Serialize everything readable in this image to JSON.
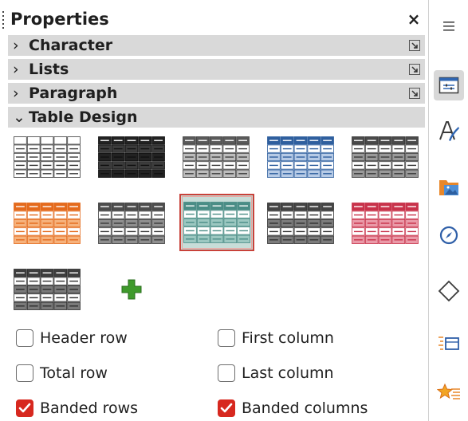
{
  "panel": {
    "title": "Properties",
    "close_glyph": "×",
    "sections": [
      {
        "label": "Character",
        "expanded": false
      },
      {
        "label": "Lists",
        "expanded": false
      },
      {
        "label": "Paragraph",
        "expanded": false
      },
      {
        "label": "Table Design",
        "expanded": true
      }
    ],
    "table_styles": [
      {
        "name": "default-style",
        "header": "#ffffff",
        "rows": [
          "#ffffff",
          "#ffffff"
        ],
        "border": "#3a3a3a",
        "selected": false
      },
      {
        "name": "dark-style",
        "header": "#222222",
        "rows": [
          "#3c3c3c",
          "#222222"
        ],
        "border": "#111111",
        "selected": false
      },
      {
        "name": "gray-style",
        "header": "#5a5a5a",
        "rows": [
          "#ffffff",
          "#bdbdbd"
        ],
        "border": "#404040",
        "selected": false
      },
      {
        "name": "blue-style",
        "header": "#2f5f9e",
        "rows": [
          "#ffffff",
          "#b7cbe6"
        ],
        "border": "#2f5f9e",
        "selected": false
      },
      {
        "name": "charcoal-style",
        "header": "#4a4a4a",
        "rows": [
          "#ffffff",
          "#9a9a9a"
        ],
        "border": "#3a3a3a",
        "selected": false
      },
      {
        "name": "orange-style",
        "header": "#e46a1c",
        "rows": [
          "#ffffff",
          "#f6b27c"
        ],
        "border": "#e46a1c",
        "selected": false
      },
      {
        "name": "mid-gray-style",
        "header": "#4d4d4d",
        "rows": [
          "#ffffff",
          "#8f8f8f"
        ],
        "border": "#3a3a3a",
        "selected": false
      },
      {
        "name": "teal-style",
        "header": "#4a8d86",
        "rows": [
          "#ffffff",
          "#9cc8c1"
        ],
        "border": "#4a8d86",
        "selected": true
      },
      {
        "name": "slate-style",
        "header": "#454545",
        "rows": [
          "#ffffff",
          "#7c7c7c"
        ],
        "border": "#333333",
        "selected": false
      },
      {
        "name": "red-style",
        "header": "#c8324a",
        "rows": [
          "#ffffff",
          "#ea9aa8"
        ],
        "border": "#c8324a",
        "selected": false
      },
      {
        "name": "graphite-style",
        "header": "#3e3e3e",
        "rows": [
          "#ffffff",
          "#7a7a7a"
        ],
        "border": "#2e2e2e",
        "selected": false
      }
    ],
    "add_style_icon": "plus-icon",
    "add_style_color": "#3f9a2c",
    "options": [
      {
        "label": "Header row",
        "checked": false
      },
      {
        "label": "First column",
        "checked": false
      },
      {
        "label": "Total row",
        "checked": false
      },
      {
        "label": "Last column",
        "checked": false
      },
      {
        "label": "Banded rows",
        "checked": true
      },
      {
        "label": "Banded columns",
        "checked": true
      }
    ],
    "checked_color": "#d7281f"
  },
  "tabbar": {
    "items": [
      {
        "icon": "hamburger-menu-icon",
        "active": false
      },
      {
        "icon": "properties-icon",
        "active": true
      },
      {
        "icon": "styles-icon",
        "active": false
      },
      {
        "icon": "gallery-icon",
        "active": false
      },
      {
        "icon": "navigator-icon",
        "active": false
      },
      {
        "icon": "shapes-icon",
        "active": false
      },
      {
        "icon": "page-icon",
        "active": false
      },
      {
        "icon": "style-inspector-icon",
        "active": false
      }
    ]
  }
}
